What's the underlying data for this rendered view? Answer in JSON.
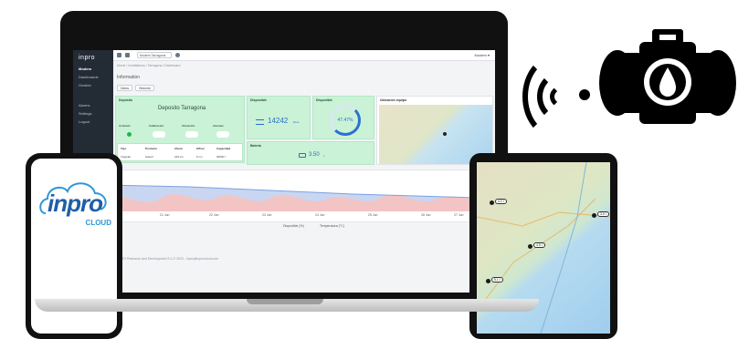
{
  "app": {
    "logo": "inpro",
    "sidebar": {
      "items": [
        "Modem",
        "Dashboards",
        "Gestión",
        "Alarms",
        "Settings",
        "Logout"
      ]
    },
    "topbar": {
      "select_value": "Modem Tarragona",
      "user": "Modem ▾"
    },
    "breadcrumb": "Home / Installations / Tarragona / Dashboard",
    "section_title": "Information",
    "tabs": [
      "Datos",
      "Historial"
    ],
    "cards": {
      "deposit": {
        "title": "Depósito",
        "name": "Deposito Tarragona",
        "status_labels": [
          "Activado",
          "Calibración",
          "Ubicación",
          "Alarmas"
        ]
      },
      "available_1": {
        "title": "Disponible",
        "value": "14242",
        "unit": "litros"
      },
      "available_2": {
        "title": "Disponible",
        "percent": "47.47%"
      },
      "battery": {
        "title": "Batería",
        "value": "3.50",
        "unit": "v"
      },
      "location": {
        "title": "Ubicación equipo"
      }
    },
    "table": {
      "headers": [
        "Tipo",
        "Producto",
        "Altura",
        "Offset",
        "Capacidad"
      ],
      "row": [
        "Irregular",
        "Gasoil",
        "229 cm",
        "0 cm",
        "30000 l"
      ]
    },
    "chart": {
      "legend": [
        "Disponible (%)",
        "Temperatura (°C)"
      ],
      "x_ticks": [
        "21 Jun",
        "22 Jun",
        "23 Jun",
        "24 Jun",
        "25 Jun",
        "26 Jun",
        "27 Jun"
      ]
    },
    "footer": "INPRO Research and Development S.L.© 2023 - inpro@inprocloud.com"
  },
  "phone": {
    "logo_text": "inpro",
    "logo_sub": "CLOUD"
  },
  "tablet": {
    "pins": [
      "4.2 l",
      "4.5 l",
      "5.1 l",
      "3.9 l"
    ]
  },
  "colors": {
    "accent": "#2e6fd1",
    "card_green": "#c9f2d7",
    "sidebar": "#232b35",
    "chart_fill": "#f3c4c4",
    "chart_line": "#7da0e0"
  },
  "icons": [
    "wireless-signal-icon",
    "tank-drop-icon"
  ]
}
